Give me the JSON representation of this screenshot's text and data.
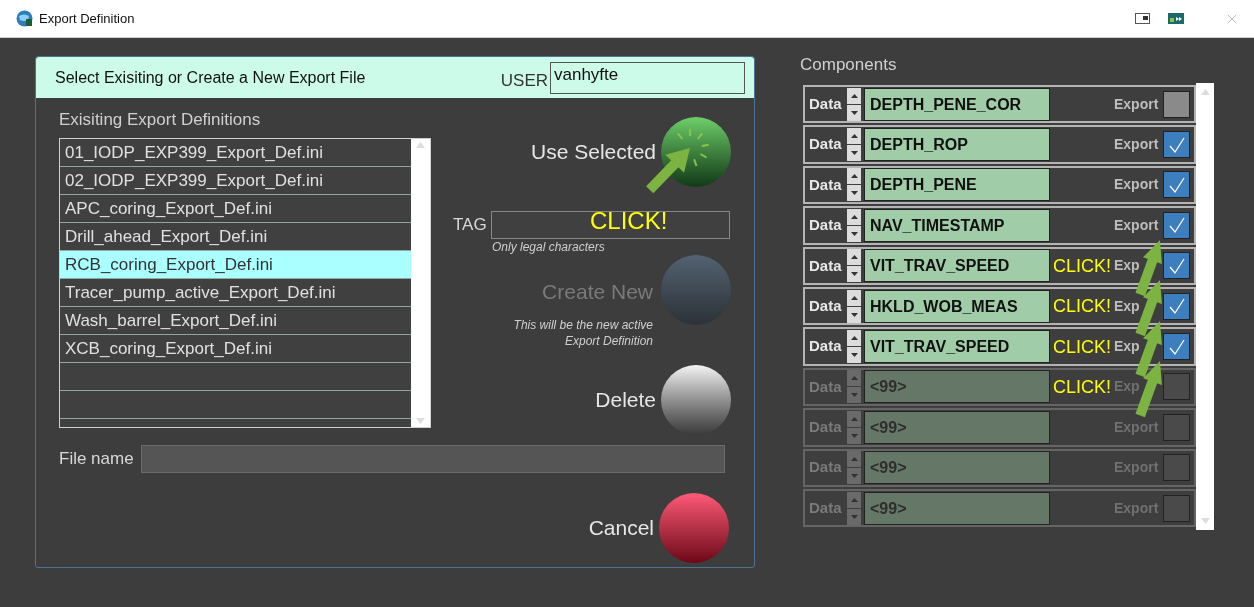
{
  "window": {
    "title": "Export Definition"
  },
  "header": {
    "title": "Select Exisiting or Create a New Export File",
    "user_label": "USER",
    "user_value": "vanhyfte"
  },
  "definitions": {
    "label": "Exisiting Export Definitions",
    "items": [
      {
        "name": "01_IODP_EXP399_Export_Def.ini",
        "selected": false
      },
      {
        "name": "02_IODP_EXP399_Export_Def.ini",
        "selected": false
      },
      {
        "name": "APC_coring_Export_Def.ini",
        "selected": false
      },
      {
        "name": "Drill_ahead_Export_Def.ini",
        "selected": false
      },
      {
        "name": "RCB_coring_Export_Def.ini",
        "selected": true
      },
      {
        "name": "Tracer_pump_active_Export_Def.ini",
        "selected": false
      },
      {
        "name": "Wash_barrel_Export_Def.ini",
        "selected": false
      },
      {
        "name": "XCB_coring_Export_Def.ini",
        "selected": false
      }
    ]
  },
  "tag": {
    "label": "TAG",
    "hint": "Only legal characters"
  },
  "actions": [
    {
      "kind": "use",
      "label": "Use Selected",
      "disabled": false
    },
    {
      "kind": "create",
      "label": "Create New",
      "disabled": true,
      "note": [
        "This will be the new active",
        "Export Definition"
      ]
    },
    {
      "kind": "delete",
      "label": "Delete",
      "disabled": false
    },
    {
      "kind": "cancel",
      "label": "Cancel",
      "disabled": false
    }
  ],
  "file_name": {
    "label": "File name"
  },
  "components": {
    "title": "Components",
    "rows": [
      {
        "label": "Data",
        "name": "DEPTH_PENE_COR",
        "export_label": "Export",
        "checked": false,
        "disabled": false
      },
      {
        "label": "Data",
        "name": "DEPTH_ROP",
        "export_label": "Export",
        "checked": true,
        "disabled": false
      },
      {
        "label": "Data",
        "name": "DEPTH_PENE",
        "export_label": "Export",
        "checked": true,
        "disabled": false
      },
      {
        "label": "Data",
        "name": "NAV_TIMESTAMP",
        "export_label": "Export",
        "checked": true,
        "disabled": false
      },
      {
        "label": "Data",
        "name": "VIT_TRAV_SPEED",
        "export_label": "Exp",
        "checked": true,
        "disabled": false
      },
      {
        "label": "Data",
        "name": "HKLD_WOB_MEAS",
        "export_label": "Exp",
        "checked": true,
        "disabled": false
      },
      {
        "label": "Data",
        "name": "VIT_TRAV_SPEED",
        "export_label": "Exp",
        "checked": true,
        "disabled": false
      },
      {
        "label": "Data",
        "name": "<99>",
        "export_label": "Exp",
        "checked": false,
        "disabled": true
      },
      {
        "label": "Data",
        "name": "<99>",
        "export_label": "Export",
        "checked": false,
        "disabled": true
      },
      {
        "label": "Data",
        "name": "<99>",
        "export_label": "Export",
        "checked": false,
        "disabled": true
      },
      {
        "label": "Data",
        "name": "<99>",
        "export_label": "Export",
        "checked": false,
        "disabled": true
      }
    ]
  },
  "annotations": [
    {
      "text": "CLICK!"
    },
    {
      "text": "CLICK!"
    },
    {
      "text": "CLICK!"
    },
    {
      "text": "CLICK!"
    },
    {
      "text": "CLICK!"
    }
  ]
}
